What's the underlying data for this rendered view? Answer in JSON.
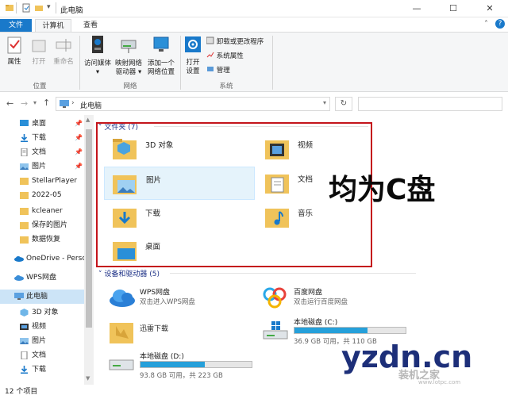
{
  "window": {
    "title": "此电脑",
    "minimize": "—",
    "maximize": "☐",
    "close": "✕"
  },
  "tabs": [
    "文件",
    "计算机",
    "查看"
  ],
  "ribbon": {
    "location_group": {
      "label": "位置",
      "buttons": [
        "属性",
        "打开",
        "重命名"
      ]
    },
    "network_group": {
      "label": "网络",
      "buttons": [
        [
          "访问媒体",
          "▾"
        ],
        [
          "映射网络",
          "驱动器 ▾"
        ],
        [
          "添加一个",
          "网络位置"
        ]
      ]
    },
    "system_group": {
      "label": "系统",
      "open_settings": [
        "打开",
        "设置"
      ],
      "small_buttons": [
        "卸载或更改程序",
        "系统属性",
        "管理"
      ]
    }
  },
  "address": {
    "path": "此电脑",
    "search_placeholder": ""
  },
  "sidebar": {
    "quick_access": [
      {
        "label": "桌面",
        "pinned": true,
        "icon": "desktop-icon"
      },
      {
        "label": "下载",
        "pinned": true,
        "icon": "download-icon"
      },
      {
        "label": "文档",
        "pinned": true,
        "icon": "document-icon"
      },
      {
        "label": "图片",
        "pinned": true,
        "icon": "picture-icon"
      },
      {
        "label": "StellarPlayer",
        "pinned": false,
        "icon": "folder-icon"
      },
      {
        "label": "2022-05",
        "pinned": false,
        "icon": "folder-icon"
      },
      {
        "label": "kcleaner",
        "pinned": false,
        "icon": "folder-icon"
      },
      {
        "label": "保存的图片",
        "pinned": false,
        "icon": "folder-icon"
      },
      {
        "label": "数据恢复",
        "pinned": false,
        "icon": "folder-icon"
      }
    ],
    "onedrive": "OneDrive - Perso",
    "wps": "WPS网盘",
    "this_pc": "此电脑",
    "this_pc_children": [
      "3D 对象",
      "视频",
      "图片",
      "文档",
      "下载"
    ]
  },
  "content": {
    "folders_header": "文件夹 (7)",
    "folders": [
      {
        "label": "3D 对象",
        "icon": "3d-objects-icon"
      },
      {
        "label": "视频",
        "icon": "videos-icon"
      },
      {
        "label": "图片",
        "icon": "pictures-icon"
      },
      {
        "label": "文档",
        "icon": "documents-icon"
      },
      {
        "label": "下载",
        "icon": "downloads-icon"
      },
      {
        "label": "音乐",
        "icon": "music-icon"
      },
      {
        "label": "桌面",
        "icon": "desktop-folder-icon"
      }
    ],
    "devices_header": "设备和驱动器 (5)",
    "devices": [
      {
        "label": "WPS网盘",
        "sub": "双击进入WPS网盘",
        "icon": "wps-cloud-icon"
      },
      {
        "label": "百度网盘",
        "sub": "双击运行百度网盘",
        "icon": "baidu-netdisk-icon"
      },
      {
        "label": "迅雷下载",
        "sub": "",
        "icon": "xunlei-icon"
      },
      {
        "label": "本地磁盘 (C:)",
        "sub": "36.9 GB 可用，共 110 GB",
        "used_fraction": 0.66,
        "icon": "windows-drive-icon"
      },
      {
        "label": "本地磁盘 (D:)",
        "sub": "93.8 GB 可用，共 223 GB",
        "used_fraction": 0.58,
        "icon": "drive-icon"
      }
    ]
  },
  "status": {
    "count": "12 个项目"
  },
  "annotation": "均为C盘",
  "watermark": {
    "main": "yzdn.cn",
    "cn": "装机之家",
    "url": "www.lotpc.com"
  },
  "colors": {
    "accent": "#1979ca",
    "highlight_box": "#c4141b",
    "folder": "#f0c35a",
    "drive_bar": "#26a0da"
  }
}
